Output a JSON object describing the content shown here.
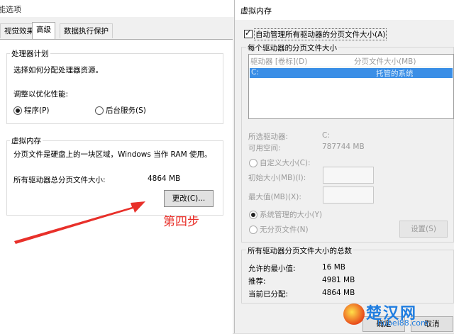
{
  "left": {
    "title": "性能选项",
    "tabs": [
      "视觉效果",
      "高级",
      "数据执行保护"
    ],
    "processor": {
      "group_title": "处理器计划",
      "desc": "选择如何分配处理器资源。",
      "adjust_label": "调整以优化性能:",
      "option_program": "程序(P)",
      "option_background": "后台服务(S)",
      "selected": "程序(P)"
    },
    "vmem": {
      "group_title": "虚拟内存",
      "desc": "分页文件是硬盘上的一块区域，Windows 当作 RAM 使用。",
      "total_label": "所有驱动器总分页文件大小:",
      "total_value": "4864 MB",
      "change_button": "更改(C)..."
    }
  },
  "right": {
    "title": "虚拟内存",
    "auto_manage": "自动管理所有驱动器的分页文件大小(A)",
    "auto_manage_checked": true,
    "per_drive_title": "每个驱动器的分页文件大小",
    "col_drive": "驱动器 [卷标](D)",
    "col_size": "分页文件大小(MB)",
    "row_drive": "C:",
    "row_size": "托管的系统",
    "selected_drive_label": "所选驱动器:",
    "selected_drive_value": "C:",
    "free_space_label": "可用空间:",
    "free_space_value": "787744 MB",
    "custom_size": "自定义大小(C):",
    "initial_size": "初始大小(MB)(I):",
    "max_size": "最大值(MB)(X):",
    "system_managed": "系统管理的大小(Y)",
    "no_paging": "无分页文件(N)",
    "set_button": "设置(S)",
    "total_title": "所有驱动器分页文件大小的总数",
    "min_allowed_label": "允许的最小值:",
    "min_allowed_value": "16 MB",
    "recommended_label": "推荐:",
    "recommended_value": "4981 MB",
    "allocated_label": "当前已分配:",
    "allocated_value": "4864 MB",
    "ok_button": "确定",
    "cancel_button": "取消"
  },
  "annotation": {
    "step_label": "第四步",
    "arrow_color": "#e8302a"
  },
  "watermark": {
    "text": "楚汉网",
    "subtext": "hubei88.com"
  }
}
